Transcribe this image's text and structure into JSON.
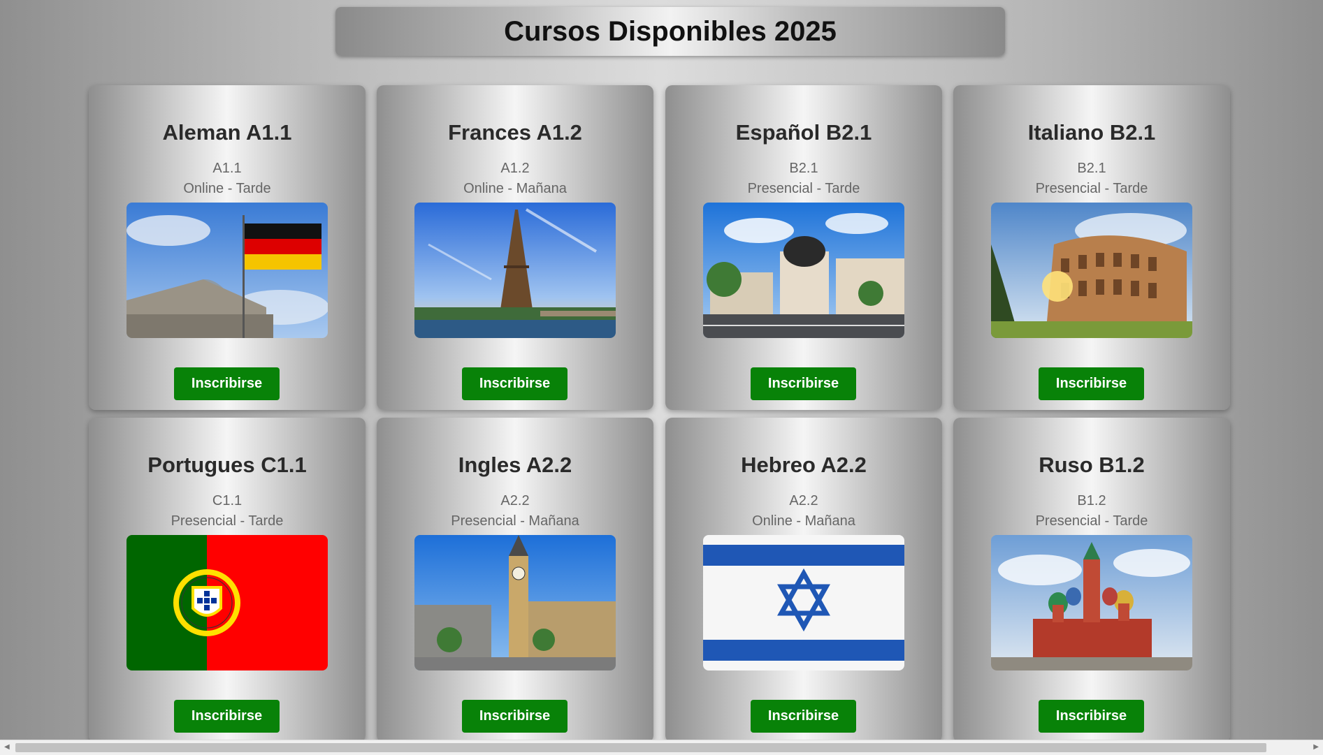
{
  "page": {
    "title": "Cursos Disponibles 2025"
  },
  "cards": [
    {
      "title": "Aleman A1.1",
      "level": "A1.1",
      "mode": "Online - Tarde",
      "image": "germany-reichstag-flag",
      "button": "Inscribirse"
    },
    {
      "title": "Frances A1.2",
      "level": "A1.2",
      "mode": "Online - Mañana",
      "image": "paris-eiffel-tower",
      "button": "Inscribirse"
    },
    {
      "title": "Español B2.1",
      "level": "B2.1",
      "mode": "Presencial - Tarde",
      "image": "madrid-metropolis",
      "button": "Inscribirse"
    },
    {
      "title": "Italiano B2.1",
      "level": "B2.1",
      "mode": "Presencial - Tarde",
      "image": "rome-colosseum",
      "button": "Inscribirse"
    },
    {
      "title": "Portugues C1.1",
      "level": "C1.1",
      "mode": "Presencial - Tarde",
      "image": "portugal-flag",
      "button": "Inscribirse"
    },
    {
      "title": "Ingles A2.2",
      "level": "A2.2",
      "mode": "Presencial - Mañana",
      "image": "london-big-ben",
      "button": "Inscribirse"
    },
    {
      "title": "Hebreo A2.2",
      "level": "A2.2",
      "mode": "Online - Mañana",
      "image": "israel-flag",
      "button": "Inscribirse"
    },
    {
      "title": "Ruso B1.2",
      "level": "B1.2",
      "mode": "Presencial - Tarde",
      "image": "moscow-st-basils",
      "button": "Inscribirse"
    }
  ],
  "colors": {
    "button": "#088208",
    "title": "#2a2a2a",
    "subtitle": "#666666"
  }
}
